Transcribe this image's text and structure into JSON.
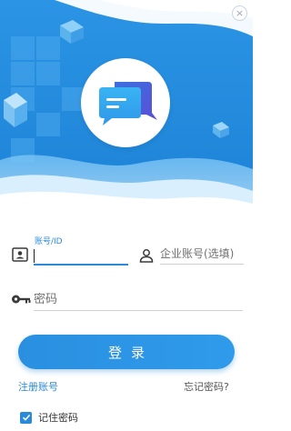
{
  "window": {
    "close_glyph": "×"
  },
  "brand": {
    "accent": "#2b8ad8",
    "header_blue": "#2a8fe0"
  },
  "form": {
    "account": {
      "label": "账号/ID",
      "value": "",
      "placeholder": ""
    },
    "company": {
      "placeholder": "企业账号(选填)"
    },
    "password": {
      "placeholder": "密码"
    },
    "login_label": "登录",
    "register_label": "注册账号",
    "forgot_label": "忘记密码?",
    "remember_label": "记住密码",
    "remember_checked": true
  },
  "icons": {
    "logo": "chat-bubbles-icon",
    "account": "id-card-icon",
    "company": "person-icon",
    "password": "key-icon",
    "checkbox": "check-icon"
  }
}
